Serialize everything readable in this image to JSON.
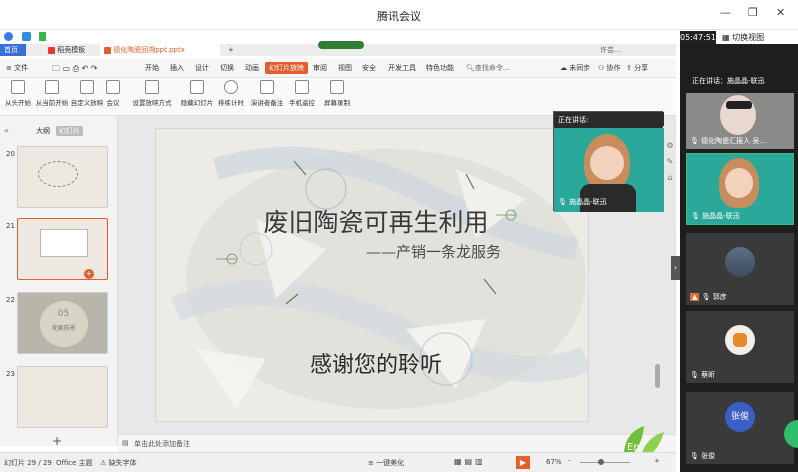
{
  "window": {
    "title": "腾讯会议",
    "time": "05:47:51",
    "switch_view": "切换视图"
  },
  "wps": {
    "doc_tabs": [
      "首页",
      "稻壳模板",
      "德化陶瓷回溯ppt.pptx"
    ],
    "new_tab": "+",
    "user": "许芸...",
    "file_menu": "文件",
    "menus": [
      "开始",
      "插入",
      "设计",
      "切换",
      "动画",
      "幻灯片放映",
      "审阅",
      "视图",
      "安全",
      "开发工具",
      "特色功能"
    ],
    "search": "查找命令...",
    "sync": "未同步",
    "collab": "协作",
    "share": "分享",
    "ribbon": [
      "从头开始",
      "从当前开始",
      "自定义放映",
      "会议",
      "设置放映方式",
      "隐藏幻灯片",
      "排练计时",
      "演讲者备注",
      "手机遥控",
      "屏幕录制"
    ]
  },
  "panel": {
    "tab_outline": "大纲",
    "tab_slides": "幻灯片",
    "thumb_numbers": [
      "20",
      "21",
      "22",
      "23"
    ],
    "thumb22_text": "05",
    "thumb22_sub": "发展前景",
    "add": "+"
  },
  "slide": {
    "title": "废旧陶瓷可再生利用",
    "subtitle": "——产销一条龙服务",
    "thanks": "感谢您的聆听"
  },
  "notes": {
    "placeholder": "单击此处添加备注"
  },
  "status": {
    "slide_count": "幻灯片 29 / 29",
    "theme": "Office 主题",
    "font_missing": "缺失字体",
    "beautify": "一键美化",
    "zoom": "67%",
    "minus": "-",
    "plus": "+"
  },
  "meeting": {
    "speaking_label": "正在讲话：施晶晶-联迅",
    "float_speaking": "正在讲话:",
    "float_name": "施晶晶-联迅",
    "participants": [
      {
        "name": "德化陶瓷汇报人 吴...",
        "avatar_text": ""
      },
      {
        "name": "施晶晶-联迅",
        "avatar_text": ""
      },
      {
        "name": "郭彦",
        "avatar_text": ""
      },
      {
        "name": "蔡昕",
        "avatar_text": ""
      },
      {
        "name": "张俊",
        "avatar_text": "张俊"
      }
    ]
  },
  "colors": {
    "wps_accent": "#e45e2e",
    "active_tile_border": "#38c172",
    "avatar_blue": "#3b5fc4"
  }
}
